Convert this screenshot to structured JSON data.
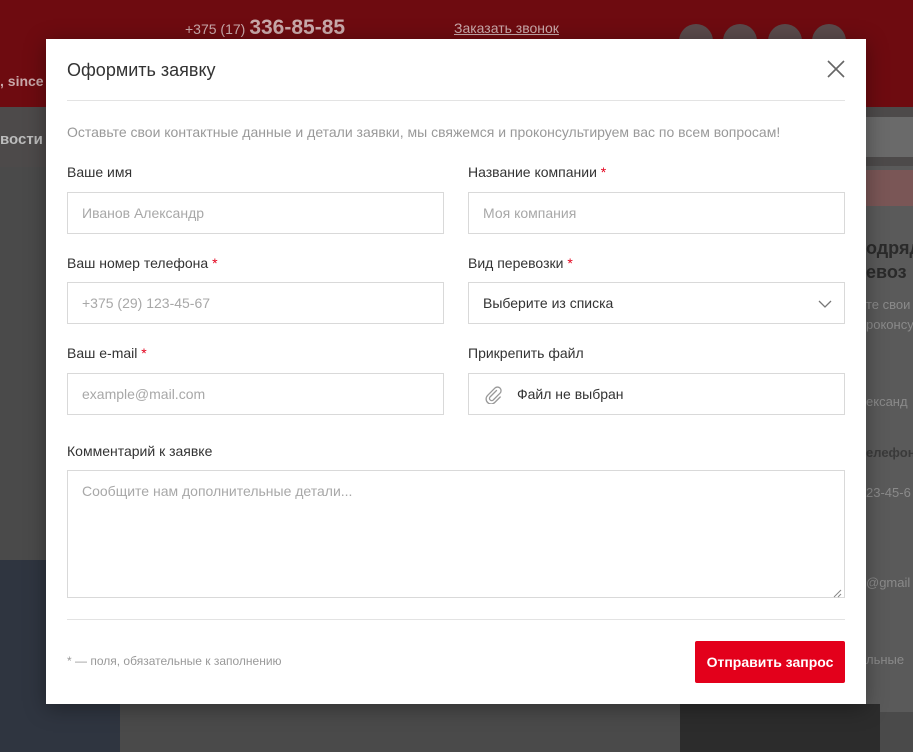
{
  "background": {
    "phone_code": "+375 (17)",
    "phone_number": "336-85-85",
    "callback_link": "Заказать звонок",
    "since_text": ", since",
    "nav_text": "вости",
    "card_title": "одряд\nевоз",
    "card_lines": [
      "те свои к",
      "роконсуль",
      "ександ",
      "елефон",
      "23-45-6",
      "@gmail",
      "льные"
    ]
  },
  "modal": {
    "title": "Оформить заявку",
    "intro": "Оставьте свои контактные данные и детали заявки, мы свяжемся и проконсультируем вас по всем вопросам!",
    "required_mark": "*",
    "fields": {
      "name": {
        "label": "Ваше имя",
        "placeholder": "Иванов Александр"
      },
      "company": {
        "label": "Название компании",
        "placeholder": "Моя компания"
      },
      "phone": {
        "label": "Ваш номер телефона",
        "placeholder": "+375 (29) 123-45-67"
      },
      "transport": {
        "label": "Вид перевозки",
        "value": "Выберите из списка"
      },
      "email": {
        "label": "Ваш e-mail",
        "placeholder": "example@mail.com"
      },
      "file": {
        "label": "Прикрепить файл",
        "value": "Файл не выбран"
      },
      "comment": {
        "label": "Комментарий к заявке",
        "placeholder": "Сообщите нам дополнительные детали..."
      }
    },
    "footnote": "* — поля, обязательные к заполнению",
    "submit_label": "Отправить запрос"
  },
  "colors": {
    "accent": "#e3001b",
    "overlay_header": "#6e0b10"
  }
}
